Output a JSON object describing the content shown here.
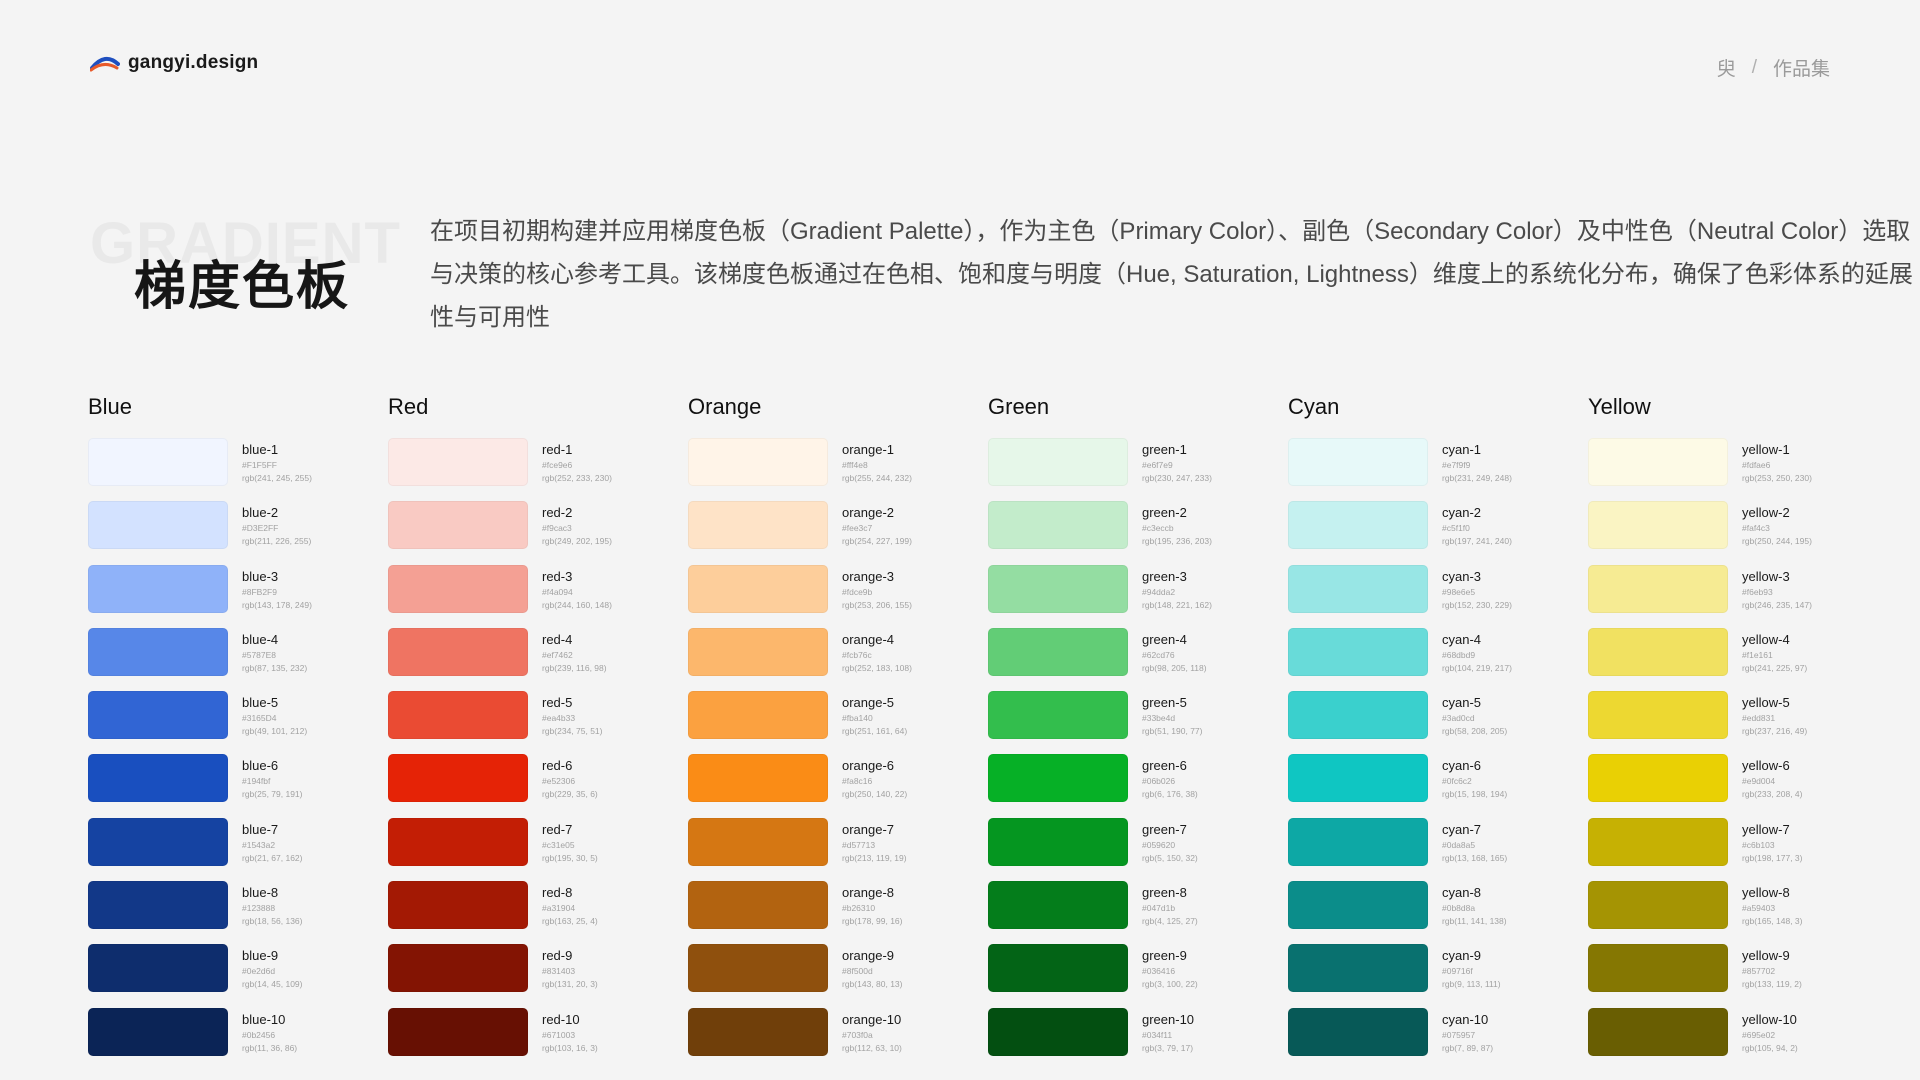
{
  "header": {
    "logo_text": "gangyi.design",
    "breadcrumb": [
      "臾",
      "/",
      "作品集"
    ]
  },
  "hero": {
    "ghost_text": "GRADIENT",
    "title": "梯度色板",
    "description": "在项目初期构建并应用梯度色板（Gradient Palette），作为主色（Primary Color）、副色（Secondary Color）及中性色（Neutral Color）选取与决策的核心参考工具。该梯度色板通过在色相、饱和度与明度（Hue, Saturation, Lightness）维度上的系统化分布，确保了色彩体系的延展性与可用性"
  },
  "palettes": [
    {
      "title": "Blue",
      "swatches": [
        {
          "name": "blue-1",
          "hex": "#F1F5FF",
          "rgb": "rgb(241, 245, 255)"
        },
        {
          "name": "blue-2",
          "hex": "#D3E2FF",
          "rgb": "rgb(211, 226, 255)"
        },
        {
          "name": "blue-3",
          "hex": "#8FB2F9",
          "rgb": "rgb(143, 178, 249)"
        },
        {
          "name": "blue-4",
          "hex": "#5787E8",
          "rgb": "rgb(87, 135, 232)"
        },
        {
          "name": "blue-5",
          "hex": "#3165D4",
          "rgb": "rgb(49, 101, 212)"
        },
        {
          "name": "blue-6",
          "hex": "#194fbf",
          "rgb": "rgb(25, 79, 191)"
        },
        {
          "name": "blue-7",
          "hex": "#1543a2",
          "rgb": "rgb(21, 67, 162)"
        },
        {
          "name": "blue-8",
          "hex": "#123888",
          "rgb": "rgb(18, 56, 136)"
        },
        {
          "name": "blue-9",
          "hex": "#0e2d6d",
          "rgb": "rgb(14, 45, 109)"
        },
        {
          "name": "blue-10",
          "hex": "#0b2456",
          "rgb": "rgb(11, 36, 86)"
        }
      ]
    },
    {
      "title": "Red",
      "swatches": [
        {
          "name": "red-1",
          "hex": "#fce9e6",
          "rgb": "rgb(252, 233, 230)"
        },
        {
          "name": "red-2",
          "hex": "#f9cac3",
          "rgb": "rgb(249, 202, 195)"
        },
        {
          "name": "red-3",
          "hex": "#f4a094",
          "rgb": "rgb(244, 160, 148)"
        },
        {
          "name": "red-4",
          "hex": "#ef7462",
          "rgb": "rgb(239, 116, 98)"
        },
        {
          "name": "red-5",
          "hex": "#ea4b33",
          "rgb": "rgb(234, 75, 51)"
        },
        {
          "name": "red-6",
          "hex": "#e52306",
          "rgb": "rgb(229, 35, 6)"
        },
        {
          "name": "red-7",
          "hex": "#c31e05",
          "rgb": "rgb(195, 30, 5)"
        },
        {
          "name": "red-8",
          "hex": "#a31904",
          "rgb": "rgb(163, 25, 4)"
        },
        {
          "name": "red-9",
          "hex": "#831403",
          "rgb": "rgb(131, 20, 3)"
        },
        {
          "name": "red-10",
          "hex": "#671003",
          "rgb": "rgb(103, 16, 3)"
        }
      ]
    },
    {
      "title": "Orange",
      "swatches": [
        {
          "name": "orange-1",
          "hex": "#fff4e8",
          "rgb": "rgb(255, 244, 232)"
        },
        {
          "name": "orange-2",
          "hex": "#fee3c7",
          "rgb": "rgb(254, 227, 199)"
        },
        {
          "name": "orange-3",
          "hex": "#fdce9b",
          "rgb": "rgb(253, 206, 155)"
        },
        {
          "name": "orange-4",
          "hex": "#fcb76c",
          "rgb": "rgb(252, 183, 108)"
        },
        {
          "name": "orange-5",
          "hex": "#fba140",
          "rgb": "rgb(251, 161, 64)"
        },
        {
          "name": "orange-6",
          "hex": "#fa8c16",
          "rgb": "rgb(250, 140, 22)"
        },
        {
          "name": "orange-7",
          "hex": "#d57713",
          "rgb": "rgb(213, 119, 19)"
        },
        {
          "name": "orange-8",
          "hex": "#b26310",
          "rgb": "rgb(178, 99, 16)"
        },
        {
          "name": "orange-9",
          "hex": "#8f500d",
          "rgb": "rgb(143, 80, 13)"
        },
        {
          "name": "orange-10",
          "hex": "#703f0a",
          "rgb": "rgb(112, 63, 10)"
        }
      ]
    },
    {
      "title": "Green",
      "swatches": [
        {
          "name": "green-1",
          "hex": "#e6f7e9",
          "rgb": "rgb(230, 247, 233)"
        },
        {
          "name": "green-2",
          "hex": "#c3eccb",
          "rgb": "rgb(195, 236, 203)"
        },
        {
          "name": "green-3",
          "hex": "#94dda2",
          "rgb": "rgb(148, 221, 162)"
        },
        {
          "name": "green-4",
          "hex": "#62cd76",
          "rgb": "rgb(98, 205, 118)"
        },
        {
          "name": "green-5",
          "hex": "#33be4d",
          "rgb": "rgb(51, 190, 77)"
        },
        {
          "name": "green-6",
          "hex": "#06b026",
          "rgb": "rgb(6, 176, 38)"
        },
        {
          "name": "green-7",
          "hex": "#059620",
          "rgb": "rgb(5, 150, 32)"
        },
        {
          "name": "green-8",
          "hex": "#047d1b",
          "rgb": "rgb(4, 125, 27)"
        },
        {
          "name": "green-9",
          "hex": "#036416",
          "rgb": "rgb(3, 100, 22)"
        },
        {
          "name": "green-10",
          "hex": "#034f11",
          "rgb": "rgb(3, 79, 17)"
        }
      ]
    },
    {
      "title": "Cyan",
      "swatches": [
        {
          "name": "cyan-1",
          "hex": "#e7f9f9",
          "rgb": "rgb(231, 249, 248)"
        },
        {
          "name": "cyan-2",
          "hex": "#c5f1f0",
          "rgb": "rgb(197, 241, 240)"
        },
        {
          "name": "cyan-3",
          "hex": "#98e6e5",
          "rgb": "rgb(152, 230, 229)"
        },
        {
          "name": "cyan-4",
          "hex": "#68dbd9",
          "rgb": "rgb(104, 219, 217)"
        },
        {
          "name": "cyan-5",
          "hex": "#3ad0cd",
          "rgb": "rgb(58, 208, 205)"
        },
        {
          "name": "cyan-6",
          "hex": "#0fc6c2",
          "rgb": "rgb(15, 198, 194)"
        },
        {
          "name": "cyan-7",
          "hex": "#0da8a5",
          "rgb": "rgb(13, 168, 165)"
        },
        {
          "name": "cyan-8",
          "hex": "#0b8d8a",
          "rgb": "rgb(11, 141, 138)"
        },
        {
          "name": "cyan-9",
          "hex": "#09716f",
          "rgb": "rgb(9, 113, 111)"
        },
        {
          "name": "cyan-10",
          "hex": "#075957",
          "rgb": "rgb(7, 89, 87)"
        }
      ]
    },
    {
      "title": "Yellow",
      "swatches": [
        {
          "name": "yellow-1",
          "hex": "#fdfae6",
          "rgb": "rgb(253, 250, 230)"
        },
        {
          "name": "yellow-2",
          "hex": "#faf4c3",
          "rgb": "rgb(250, 244, 195)"
        },
        {
          "name": "yellow-3",
          "hex": "#f6eb93",
          "rgb": "rgb(246, 235, 147)"
        },
        {
          "name": "yellow-4",
          "hex": "#f1e161",
          "rgb": "rgb(241, 225, 97)"
        },
        {
          "name": "yellow-5",
          "hex": "#edd831",
          "rgb": "rgb(237, 216, 49)"
        },
        {
          "name": "yellow-6",
          "hex": "#e9d004",
          "rgb": "rgb(233, 208, 4)"
        },
        {
          "name": "yellow-7",
          "hex": "#c6b103",
          "rgb": "rgb(198, 177, 3)"
        },
        {
          "name": "yellow-8",
          "hex": "#a59403",
          "rgb": "rgb(165, 148, 3)"
        },
        {
          "name": "yellow-9",
          "hex": "#857702",
          "rgb": "rgb(133, 119, 2)"
        },
        {
          "name": "yellow-10",
          "hex": "#695e02",
          "rgb": "rgb(105, 94, 2)"
        }
      ]
    }
  ]
}
